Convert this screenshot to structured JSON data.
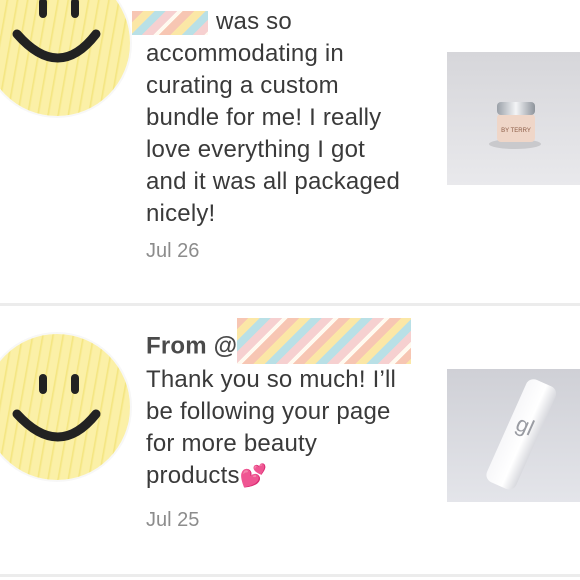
{
  "reviews": [
    {
      "avatar_icon": "smiley-face-icon",
      "text_lines_before": "was so",
      "text_lines": [
        "accommodating in",
        "curating a custom",
        "bundle for me! I really",
        "love everything I got",
        "and it was all packaged",
        "nicely!"
      ],
      "date": "Jul 26",
      "thumbnail_icon": "cream-jar-icon",
      "thumbnail_label": "BY TERRY"
    },
    {
      "avatar_icon": "smiley-face-icon",
      "from_label": "From @",
      "text_lines": [
        "Thank you so much! I’ll",
        "be following your page",
        "for more beauty",
        "products"
      ],
      "emoji": "💕",
      "date": "Jul 25",
      "thumbnail_icon": "white-bottle-icon",
      "thumbnail_label": "gl"
    }
  ]
}
